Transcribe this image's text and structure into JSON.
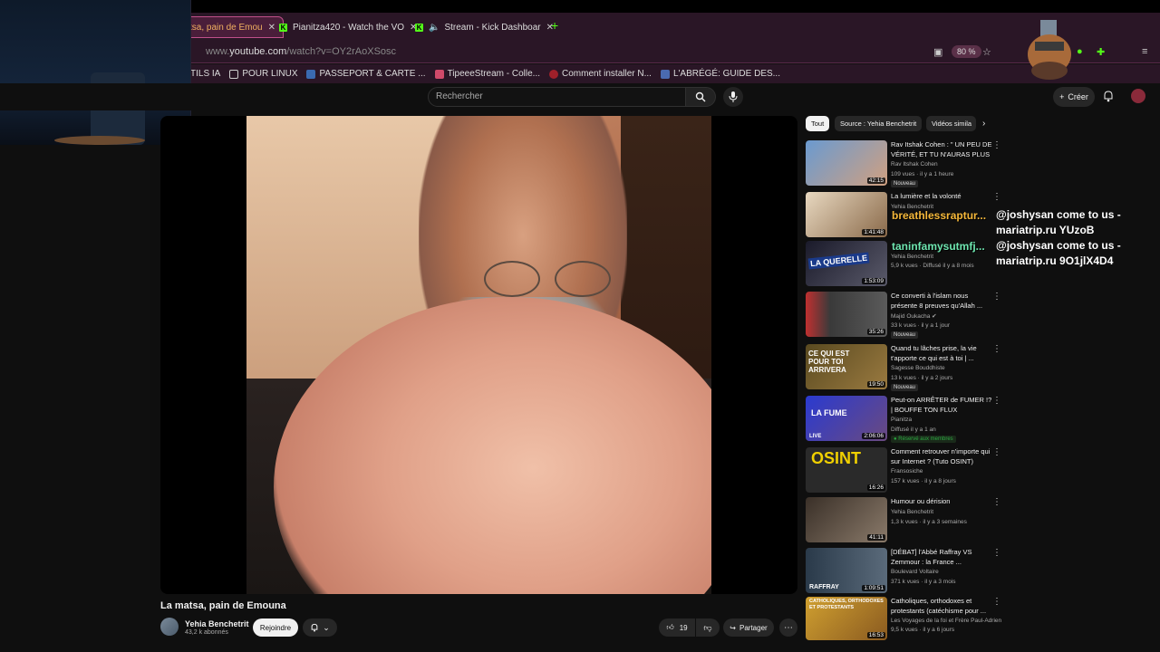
{
  "browser": {
    "tabs": [
      {
        "label": "tsa, pain de Emou",
        "active": true
      },
      {
        "label": "Pianitza420 - Watch the VO",
        "active": false
      },
      {
        "label": "Stream - Kick Dashboar",
        "active": false
      }
    ],
    "url_prefix": "www.",
    "url_domain": "youtube.com",
    "url_path": "/watch?v=OY2rAoXSosc",
    "zoom": "80 %",
    "bookmarks": [
      "TILS IA",
      "POUR LINUX",
      "PASSEPORT & CARTE ...",
      "TipeeeStream - Colle...",
      "Comment installer N...",
      "L'ABRÉGÉ: GUIDE DES..."
    ]
  },
  "header": {
    "search_placeholder": "Rechercher",
    "create_label": "Créer"
  },
  "video": {
    "title": "La matsa, pain de Emouna",
    "channel": "Yehia Benchetrit",
    "subscribers": "43,2 k abonnés",
    "join_label": "Rejoindre",
    "likes": "19",
    "share_label": "Partager"
  },
  "chips": [
    "Tout",
    "Source : Yehia Benchetrit",
    "Vidéos simila"
  ],
  "recommendations": [
    {
      "title": "Rav Itshak Cohen  : \" UN PEU DE VÉRITÉ, ET TU N'AURAS PLUS ...",
      "channel": "Rav Itshak Cohen",
      "meta": "109 vues · il y a 1 heure",
      "duration": "42:15",
      "badge": "Nouveau",
      "thumb_color": "#5a8ac0"
    },
    {
      "title": "La lumière et la volonté",
      "channel": "Yehia Benchetrit",
      "meta": "",
      "duration": "1:41:48",
      "badge": "",
      "thumb_color": "#c8a878"
    },
    {
      "title": "",
      "channel": "Yehia Benchetrit",
      "meta": "5,9 k vues · Diffusé il y a 8 mois",
      "duration": "1:53:09",
      "badge": "",
      "thumb_color": "#2a2a3a",
      "thumb_text": "LA QUERELLE"
    },
    {
      "title": "Ce converti à l'islam nous présente 8 preuves qu'Allah ...",
      "channel": "Majid Oukacha",
      "meta": "33 k vues · il y a 1 jour",
      "duration": "35:26",
      "badge": "Nouveau",
      "thumb_color": "#3a3a3a"
    },
    {
      "title": "Quand tu lâches prise, la vie t'apporte ce qui est à toi | ...",
      "channel": "Sagesse Bouddhiste",
      "meta": "13 k vues · il y a 2 jours",
      "duration": "19:50",
      "badge": "Nouveau",
      "thumb_color": "#6a5a30",
      "thumb_text": "CE QUI EST POUR TOI ARRIVERA"
    },
    {
      "title": "Peut-on ARRÊTER de FUMER !? | BOUFFE TON FLUX",
      "channel": "Pianitza",
      "meta": "Diffusé il y a 1 an",
      "duration": "2:06:06",
      "badge": "",
      "members": "Réservé aux membres",
      "thumb_color": "#2a4ac0",
      "thumb_text": "LA FUME"
    },
    {
      "title": "Comment retrouver n'importe qui sur Internet ? (Tuto OSINT)",
      "channel": "Fransosiche",
      "meta": "157 k vues · il y a 8 jours",
      "duration": "16:26",
      "badge": "",
      "thumb_color": "#2a2a2a",
      "thumb_text": "OSINT"
    },
    {
      "title": "Humour ou dérision",
      "channel": "Yehia Benchetrit",
      "meta": "1,3 k vues · il y a 3 semaines",
      "duration": "41:11",
      "badge": "",
      "thumb_color": "#4a3a30"
    },
    {
      "title": "[DÉBAT] l'Abbé Raffray VS Zemmour : la France ...",
      "channel": "Boulevard Voltaire",
      "meta": "371 k vues · il y a 3 mois",
      "duration": "1:09:51",
      "badge": "",
      "thumb_color": "#3a4a5a",
      "thumb_text": "RAFFRAY"
    },
    {
      "title": "Catholiques, orthodoxes et protestants (catéchisme pour ...",
      "channel": "Les Voyages de la foi et Frère Paul-Adrien",
      "meta": "9,5 k vues · il y a 6 jours",
      "duration": "16:53",
      "badge": "",
      "thumb_color": "#c89a30",
      "thumb_text": "CATHOLIQUES, ORTHODOXES ET PROTESTANTS"
    }
  ],
  "overlay": {
    "user1": "breathlessraptur...",
    "user2": "taninfamysutmfj...",
    "msg1_line1": "@joshysan come to us -",
    "msg1_line2": "mariatrip.ru YUzoB",
    "msg2_line1": "@joshysan come to us -",
    "msg2_line2": "mariatrip.ru 9O1jlX4D4"
  }
}
